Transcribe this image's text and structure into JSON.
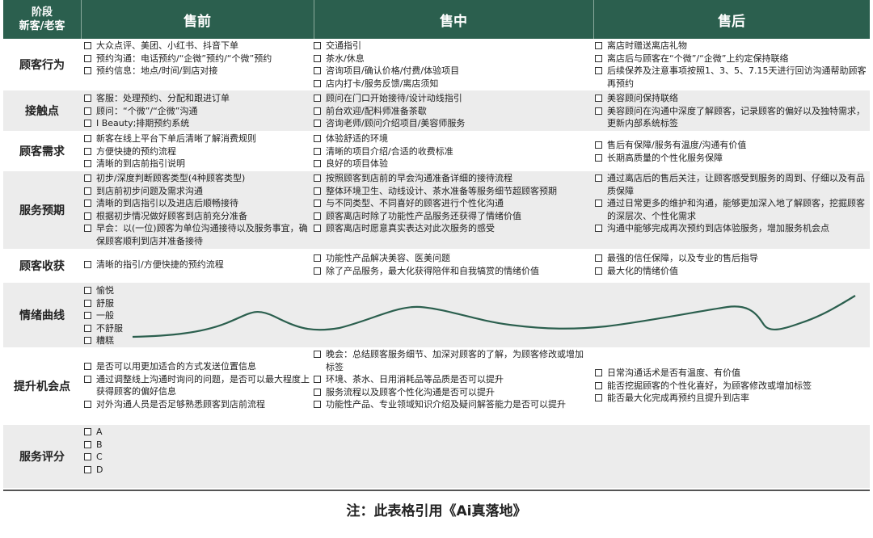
{
  "header": {
    "first_line1": "阶段",
    "first_line2": "新客/老客",
    "stages": [
      "售前",
      "售中",
      "售后"
    ]
  },
  "rows": {
    "behavior": {
      "label": "顾客行为",
      "pre": [
        "大众点评、美团、小红书、抖音下单",
        "预约沟通：电话预约/“企微”预约/“个微”预约",
        "预约信息：地点/时间/到店对接"
      ],
      "mid": [
        "交通指引",
        "茶水/休息",
        "咨询项目/确认价格/付费/体验项目",
        "店内打卡/服务反馈/离店须知"
      ],
      "post": [
        "离店时赠送离店礼物",
        "离店后与顾客在“个微”/“企微”上约定保持联络",
        "后续保养及注意事项按照1、3、5、7.15天进行回访沟通帮助顾客再预约"
      ]
    },
    "touch": {
      "label": "接触点",
      "pre": [
        "客服：处理预约、分配和跟进订单",
        "顾问：“个微”/“企微”沟通",
        "I Beauty;排期预约系统"
      ],
      "mid": [
        "顾问在门口开始接待/设计动线指引",
        "前台欢迎/配料师准备茶歇",
        "咨询老师/顾问介绍项目/美容师服务"
      ],
      "post": [
        "美容顾问保持联络",
        "美容顾问在沟通中深度了解顾客，记录顾客的偏好以及独特需求，更新内部系统标签"
      ]
    },
    "needs": {
      "label": "顾客需求",
      "pre": [
        "新客在线上平台下单后清晰了解消费规则",
        "方便快捷的预约流程",
        "清晰的到店前指引说明"
      ],
      "mid": [
        "体验舒适的环境",
        "清晰的项目介绍/合适的收费标准",
        "良好的项目体验"
      ],
      "post": [
        "售后有保障/服务有温度/沟通有价值",
        "长期高质量的个性化服务保障"
      ]
    },
    "expect": {
      "label": "服务预期",
      "pre": [
        "初步/深度判断顾客类型(4种顾客类型)",
        "到店前初步问题及需求沟通",
        "清晰的到店指引以及进店后顺畅接待",
        "根据初步情况做好顾客到店前充分准备",
        "早会：以(一位)顾客为单位沟通接待以及服务事宜，确保顾客顺利到店并准备接待"
      ],
      "mid": [
        "按照顾客到店前的早会沟通准备详细的接待流程",
        "整体环境卫生、动线设计、茶水准备等服务细节超顾客预期",
        "与不同类型、不同喜好的顾客进行个性化沟通",
        "顾客离店时除了功能性产品服务还获得了情绪价值",
        "顾客离店时愿意真实表达对此次服务的感受"
      ],
      "post": [
        "通过离店后的售后关注，让顾客感受到服务的周到、仔细以及有品质保障",
        "通过日常更多的维护和沟通，能够更加深入地了解顾客，挖掘顾客的深层次、个性化需求",
        "沟通中能够完成再次预约到店体验服务，增加服务机会点"
      ]
    },
    "gain": {
      "label": "顾客收获",
      "pre": [
        "清晰的指引/方便快捷的预约流程"
      ],
      "mid": [
        "功能性产品解决美容、医美问题",
        "除了产品服务，最大化获得陪伴和自我犒赏的情绪价值"
      ],
      "post": [
        "最强的信任保障，以及专业的售后指导",
        "最大化的情绪价值"
      ]
    },
    "emotion": {
      "label": "情绪曲线",
      "levels": [
        "愉悦",
        "舒服",
        "一般",
        "不舒服",
        "糟糕"
      ]
    },
    "improve": {
      "label": "提升机会点",
      "pre": [
        "是否可以用更加适合的方式发送位置信息",
        "通过调整线上沟通时询问的问题，是否可以最大程度上获得顾客的偏好信息",
        "对外沟通人员是否足够熟悉顾客到店前流程"
      ],
      "mid": [
        "晚会：总结顾客服务细节、加深对顾客的了解，为顾客修改或增加标签",
        "环境、茶水、日用消耗品等品质是否可以提升",
        "服务流程以及顾客个性化沟通是否可以提升",
        "功能性产品、专业领域知识介绍及疑问解答能力是否可以提升"
      ],
      "post": [
        "日常沟通话术是否有温度、有价值",
        "能否挖掘顾客的个性化喜好，为顾客修改或增加标签",
        "能否最大化完成再预约且提升到店率"
      ]
    },
    "rating": {
      "label": "服务评分",
      "levels": [
        "A",
        "B",
        "C",
        "D"
      ]
    }
  },
  "note": "注：此表格引用《Ai真落地》",
  "colors": {
    "header_bg": "#2b5f4e",
    "curve": "#2b5f4e",
    "alt_row": "#ececec"
  }
}
